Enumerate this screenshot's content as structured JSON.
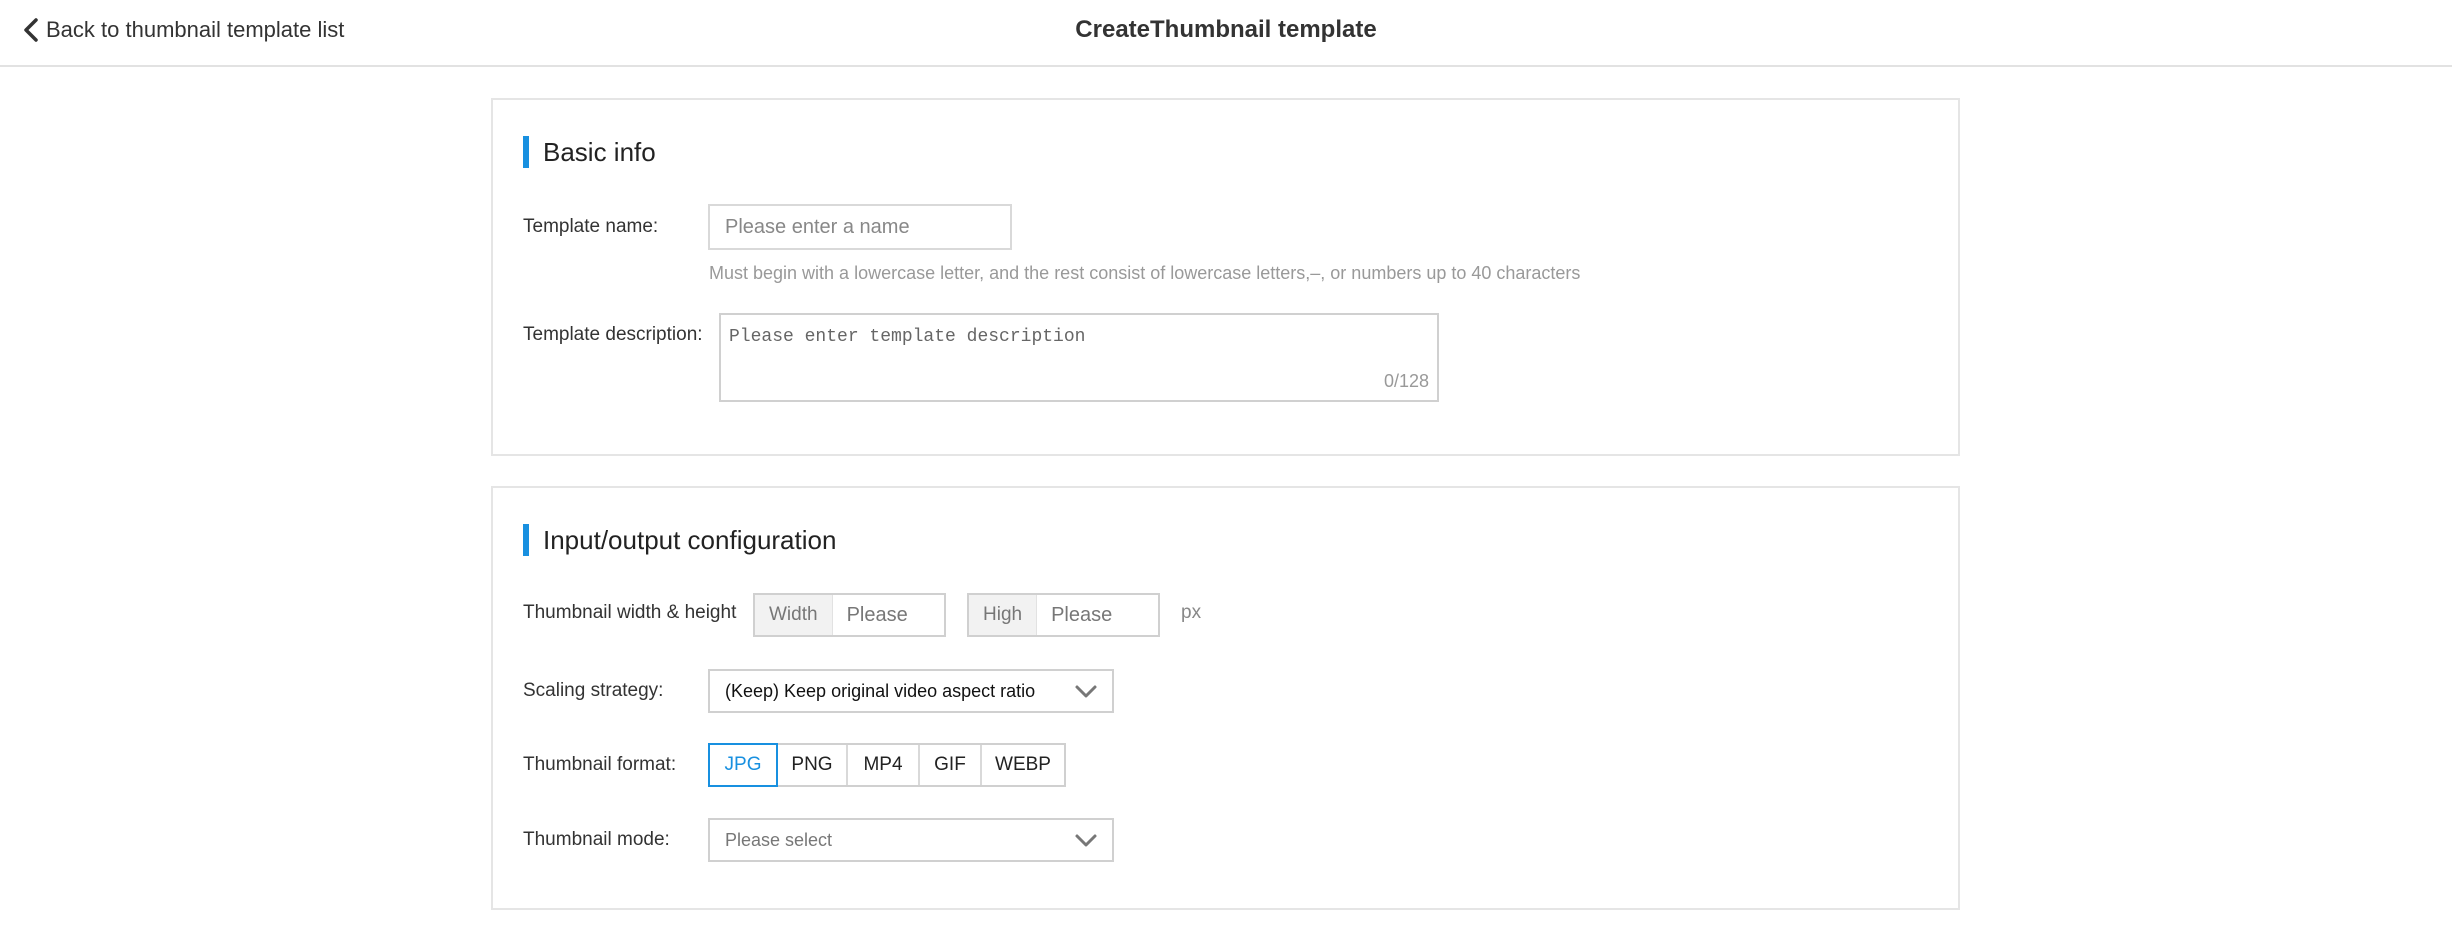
{
  "header": {
    "back_label": "Back to thumbnail template list",
    "title": "CreateThumbnail template"
  },
  "accent_color": "#1890e0",
  "basic_info": {
    "title": "Basic info",
    "template_name": {
      "label": "Template name:",
      "placeholder": "Please enter a name",
      "value": "",
      "hint": "Must begin with a lowercase letter, and the rest consist of lowercase letters,–, or numbers up to 40 characters"
    },
    "template_description": {
      "label": "Template description:",
      "placeholder": "Please enter template description",
      "value": "",
      "counter": "0/128"
    }
  },
  "io_config": {
    "title": "Input/output configuration",
    "size": {
      "label": "Thumbnail width & height",
      "width_prefix": "Width",
      "width_placeholder": "Please",
      "height_prefix": "High",
      "height_placeholder": "Please",
      "unit": "px"
    },
    "scaling": {
      "label": "Scaling strategy:",
      "selected": "(Keep) Keep original video aspect ratio"
    },
    "format": {
      "label": "Thumbnail format:",
      "options": [
        "JPG",
        "PNG",
        "MP4",
        "GIF",
        "WEBP"
      ],
      "selected": "JPG"
    },
    "mode": {
      "label": "Thumbnail mode:",
      "placeholder": "Please select"
    }
  },
  "icons": {
    "back": "chevron-left-icon",
    "dropdown": "chevron-down-icon"
  }
}
